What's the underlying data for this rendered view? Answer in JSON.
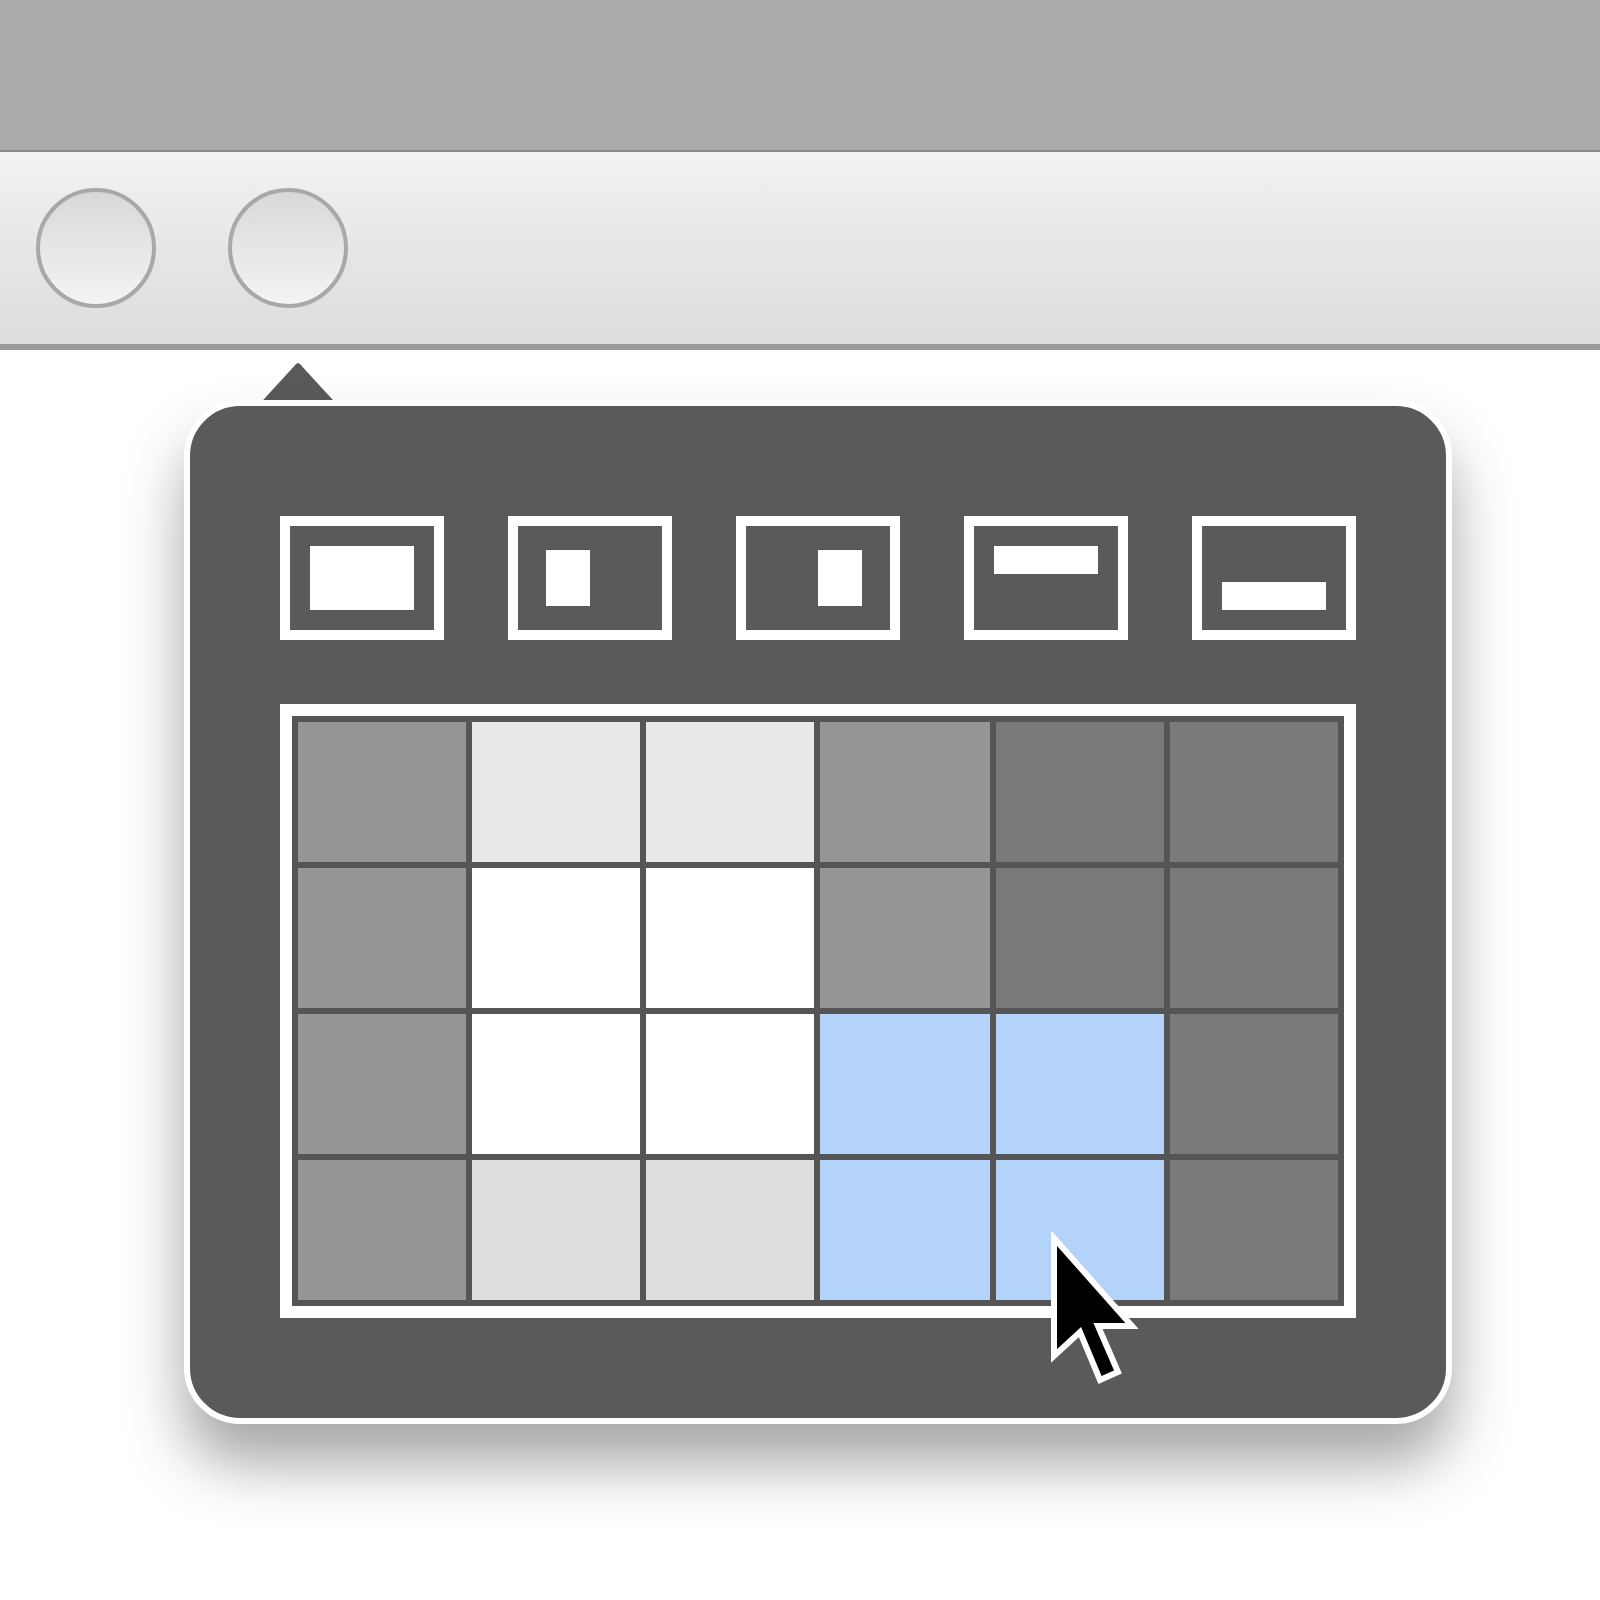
{
  "presets": [
    {
      "kind": "full"
    },
    {
      "kind": "left"
    },
    {
      "kind": "right"
    },
    {
      "kind": "top"
    },
    {
      "kind": "bottom"
    }
  ],
  "grid": {
    "rows": [
      {
        "cells": [
          {
            "color": "#959595"
          },
          {
            "color": "#e8e8e8"
          },
          {
            "color": "#e8e8e8"
          },
          {
            "color": "#959595"
          },
          {
            "color": "#7a7a7a"
          },
          {
            "color": "#7a7a7a"
          }
        ]
      },
      {
        "cells": [
          {
            "color": "#959595"
          },
          {
            "color": "#ffffff"
          },
          {
            "color": "#ffffff"
          },
          {
            "color": "#959595"
          },
          {
            "color": "#7a7a7a"
          },
          {
            "color": "#7a7a7a"
          }
        ]
      },
      {
        "cells": [
          {
            "color": "#959595"
          },
          {
            "color": "#ffffff"
          },
          {
            "color": "#ffffff"
          },
          {
            "color": "#b3d3fb"
          },
          {
            "color": "#b3d3fb"
          },
          {
            "color": "#7a7a7a"
          }
        ]
      },
      {
        "cells": [
          {
            "color": "#959595"
          },
          {
            "color": "#dedede"
          },
          {
            "color": "#dedede"
          },
          {
            "color": "#b3d3fb"
          },
          {
            "color": "#b3d3fb"
          },
          {
            "color": "#7a7a7a"
          }
        ]
      }
    ]
  }
}
